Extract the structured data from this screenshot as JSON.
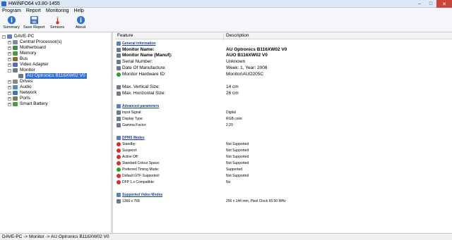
{
  "window": {
    "title": "HWiNFO64 v3.80-1455"
  },
  "menu": [
    "Program",
    "Report",
    "Monitoring",
    "Help"
  ],
  "toolbar": [
    {
      "label": "Summary",
      "icon": "info-icon"
    },
    {
      "label": "Save Report",
      "icon": "save-icon"
    },
    {
      "label": "Sensors",
      "icon": "thermometer-icon"
    },
    {
      "label": "About",
      "icon": "info-icon"
    }
  ],
  "tree": {
    "root": "DAVE-PC",
    "items": [
      "Central Processor(s)",
      "Motherboard",
      "Memory",
      "Bus",
      "Video Adapter",
      "Monitor",
      "AU Optronics B116XW02 V0",
      "Drives",
      "Audio",
      "Network",
      "Ports",
      "Smart Battery"
    ],
    "colors": {
      "selected": "#3370d4"
    }
  },
  "details": {
    "header": {
      "feature": "Feature",
      "description": "Description"
    },
    "general": {
      "title": "General information",
      "rows": [
        {
          "feature": "Monitor Name:",
          "value": "AU Optronics B116XW02 V0"
        },
        {
          "feature": "Monitor Name (Manuf):",
          "value": "AUO          B116XW02 V0"
        },
        {
          "feature": "Serial Number:",
          "value": "Unknown"
        },
        {
          "feature": "Date Of Manufacture:",
          "value": "Week: 1, Year: 2008"
        },
        {
          "feature": "Monitor Hardware ID:",
          "value": "Monitor\\AUO205C"
        },
        {
          "feature": "Max. Vertical Size:",
          "value": "14 cm"
        },
        {
          "feature": "Max. Horizontal Size:",
          "value": "26 cm"
        }
      ]
    },
    "advanced": {
      "title": "Advanced parameters",
      "rows": [
        {
          "feature": "Input Signal:",
          "value": "Digital"
        },
        {
          "feature": "Display Type:",
          "value": "RGB color"
        },
        {
          "feature": "Gamma Factor:",
          "value": "2.20"
        }
      ]
    },
    "dpms": {
      "title": "DPMS Modes",
      "rows": [
        {
          "feature": "Standby:",
          "value": "Not Supported",
          "status": "no"
        },
        {
          "feature": "Suspend:",
          "value": "Not Supported",
          "status": "no"
        },
        {
          "feature": "Active Off:",
          "value": "Not Supported",
          "status": "no"
        },
        {
          "feature": "Standard Colour Space:",
          "value": "Not Supported",
          "status": "no"
        },
        {
          "feature": "Preferred Timing Mode:",
          "value": "Supported",
          "status": "ok"
        },
        {
          "feature": "Default GTF Supported:",
          "value": "Not Supported",
          "status": "no"
        },
        {
          "feature": "DFP 1.x Compatible:",
          "value": "No",
          "status": "no"
        }
      ]
    },
    "video": {
      "title": "Supported Video Modes",
      "rows": [
        {
          "feature": "1366 x 768",
          "value": "256 x 144 mm, Pixel Clock 65.50 MHz"
        }
      ]
    }
  },
  "status": {
    "path": "DAVE-PC -> Monitor -> AU Optronics B116XW02 V0"
  },
  "colors": {
    "accent": "#3370d4",
    "ok": "#2aa02a",
    "error": "#d0302b",
    "section": "#1a3d8f"
  }
}
